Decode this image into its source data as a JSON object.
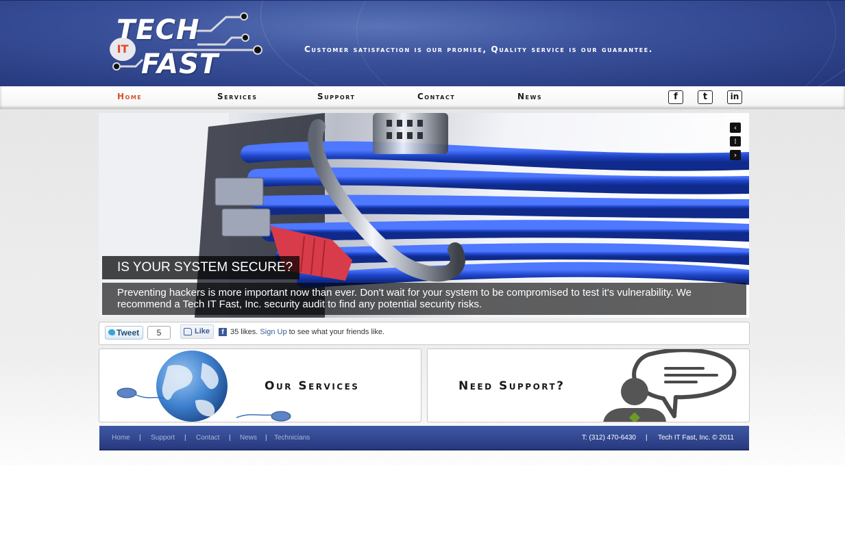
{
  "site": {
    "logo_top": "TECH",
    "logo_badge": "IT",
    "logo_bottom": "FAST",
    "tagline": "Customer satisfaction is our promise, Quality service is our guarantee."
  },
  "nav": {
    "items": [
      {
        "label": "Home",
        "active": true
      },
      {
        "label": "Services",
        "active": false
      },
      {
        "label": "Support",
        "active": false
      },
      {
        "label": "Contact",
        "active": false
      },
      {
        "label": "News",
        "active": false
      }
    ],
    "social": [
      {
        "label": "f",
        "icon": "facebook-icon"
      },
      {
        "label": "t",
        "icon": "twitter-icon"
      },
      {
        "label": "in",
        "icon": "linkedin-icon"
      }
    ]
  },
  "slider": {
    "controls": {
      "prev": "‹",
      "pause": "⁞",
      "next": "›"
    },
    "caption_title": "IS YOUR SYSTEM SECURE?",
    "caption_text": "Preventing hackers is more important now than ever. Don't wait for your system to be compromised to test it's vulnerability. We recommend a Tech IT Fast, Inc. security audit to find any potential security risks."
  },
  "social_bar": {
    "tweet_label": "Tweet",
    "tweet_count": "5",
    "like_label": "Like",
    "fb_icon": "f",
    "like_count_text": "35 likes.",
    "signup_link": "Sign Up",
    "like_suffix": "to see what your friends like."
  },
  "promos": {
    "services_title": "Our Services",
    "support_title": "Need Support?"
  },
  "footer": {
    "links": [
      "Home",
      "Support",
      "Contact",
      "News",
      "Technicians"
    ],
    "separator": "|",
    "phone": "T: (312) 470-6430",
    "copyright": "Tech IT Fast, Inc. © 2011"
  },
  "colors": {
    "header_blue": "#3a519a",
    "nav_active": "#d2532a",
    "footer_blue": "#2f4590",
    "cable_blue": "#1f45c8",
    "plug_red": "#d83b4a"
  }
}
